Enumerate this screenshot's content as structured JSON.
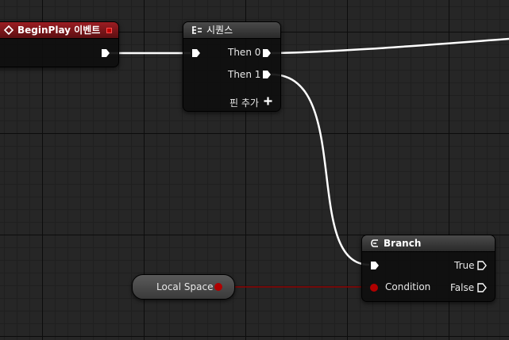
{
  "nodes": {
    "begin_play": {
      "title": "BeginPlay 이벤트"
    },
    "sequence": {
      "title": "시퀀스",
      "then0": "Then 0",
      "then1": "Then 1",
      "add_pin": "핀 추가"
    },
    "branch": {
      "title": "Branch",
      "condition": "Condition",
      "true": "True",
      "false": "False"
    },
    "local_space": {
      "label": "Local Space"
    }
  },
  "colors": {
    "exec_wire": "#ffffff",
    "bool_wire": "#8b0000",
    "event_header": "#9b1d22",
    "bool_pin": "#b00000"
  }
}
